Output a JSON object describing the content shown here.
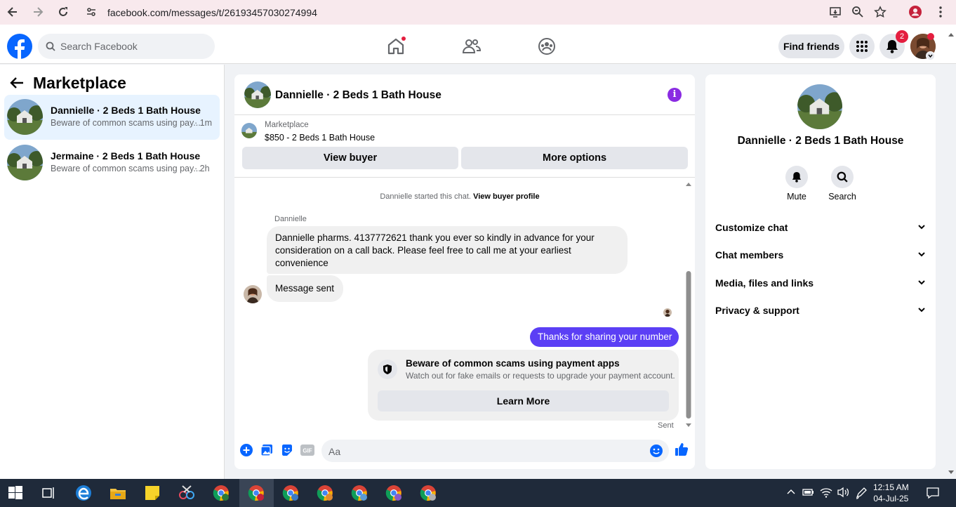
{
  "browser": {
    "url": "facebook.com/messages/t/26193457030274994"
  },
  "header": {
    "search_placeholder": "Search Facebook",
    "find_friends": "Find friends",
    "notification_count": "2"
  },
  "sidebar": {
    "title": "Marketplace",
    "conversations": [
      {
        "name": "Dannielle · 2 Beds 1 Bath House",
        "preview": "Beware of common scams using pay...",
        "time": "· 1m",
        "selected": true
      },
      {
        "name": "Jermaine · 2 Beds 1 Bath House",
        "preview": "Beware of common scams using pay...",
        "time": "· 2h",
        "selected": false
      }
    ]
  },
  "chat": {
    "title": "Dannielle · 2 Beds 1 Bath House",
    "listing_label": "Marketplace",
    "listing_price": "$850 - 2 Beds 1 Bath House",
    "view_buyer": "View buyer",
    "more_options": "More options",
    "started_text": "Dannielle started this chat.",
    "view_buyer_profile": "View buyer profile",
    "sender_name": "Dannielle",
    "messages": [
      {
        "from": "Dannielle",
        "text": "Dannielle pharms. 4137772621 thank you ever so kindly in advance for your consideration on a call back. Please feel free to call me at your earliest convenience"
      },
      {
        "from": "Dannielle",
        "text": "Message sent"
      },
      {
        "from": "me",
        "text": "Thanks for sharing your number"
      }
    ],
    "scam_title": "Beware of common scams using payment apps",
    "scam_sub": "Watch out for fake emails or requests to upgrade your payment account.",
    "learn_more": "Learn More",
    "status": "Sent",
    "input_placeholder": "Aa"
  },
  "info_panel": {
    "title": "Dannielle · 2 Beds 1 Bath House",
    "mute": "Mute",
    "search": "Search",
    "sections": [
      "Customize chat",
      "Chat members",
      "Media, files and links",
      "Privacy & support"
    ]
  },
  "taskbar": {
    "time": "12:15 AM",
    "date": "04-Jul-25"
  },
  "colors": {
    "fb_blue": "#0866ff",
    "outgoing_bubble": "#5b3ff5",
    "selected_conversation": "#e7f3ff"
  }
}
